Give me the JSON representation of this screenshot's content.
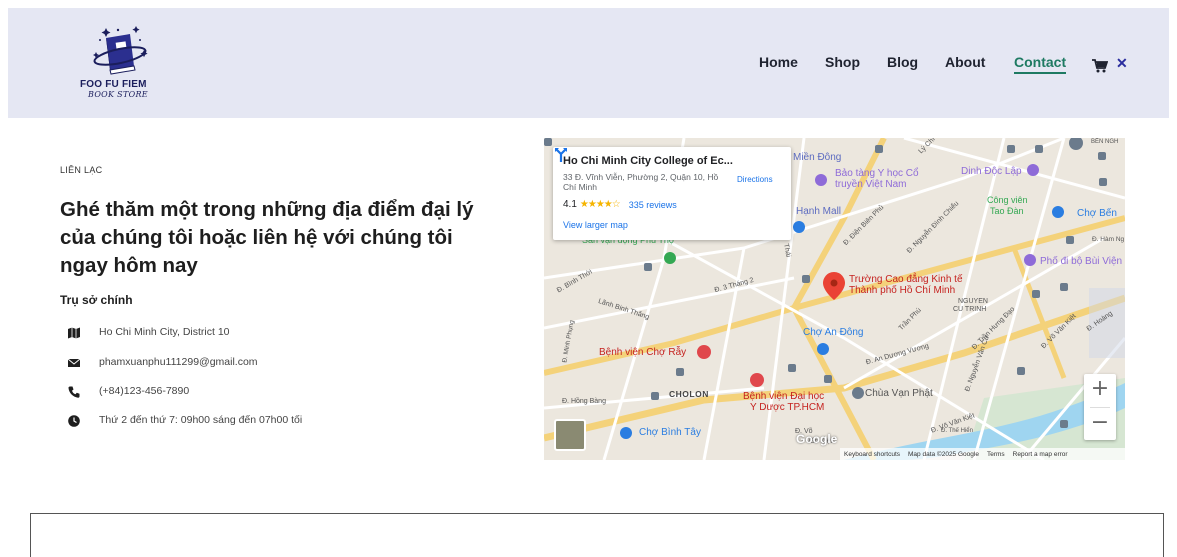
{
  "header": {
    "logo": {
      "line1": "FOO FU FIEM",
      "line2": "BOOK STORE"
    },
    "nav": [
      {
        "label": "Home"
      },
      {
        "label": "Shop"
      },
      {
        "label": "Blog"
      },
      {
        "label": "About"
      },
      {
        "label": "Contact",
        "active": true
      }
    ],
    "cart_icon": "cart-icon",
    "close_icon": "close-icon",
    "close_glyph": "✕",
    "colors": {
      "background": "#e5e7f3",
      "active": "#1e7a62",
      "text": "#1f2330"
    }
  },
  "contact": {
    "eyebrow": "LIÊN LẠC",
    "headline": "Ghé thăm một trong những địa điểm đại lý của chúng tôi hoặc liên hệ với chúng tôi ngay hôm nay",
    "hq_title": "Trụ sở chính",
    "items": [
      {
        "icon": "map-icon",
        "text": "Ho Chi Minh City, District 10"
      },
      {
        "icon": "envelope-icon",
        "text": "phamxuanphu111299@gmail.com"
      },
      {
        "icon": "phone-icon",
        "text": "(+84)123-456-7890"
      },
      {
        "icon": "clock-icon",
        "text": "Thứ 2 đến thứ 7: 09h00 sáng đến 07h00 tối"
      }
    ]
  },
  "map": {
    "card": {
      "title": "Ho Chi Minh City College of Ec...",
      "address": "33 Đ. Vĩnh Viễn, Phường 2, Quận 10, Hồ Chí Minh",
      "rating": "4.1",
      "stars": "★★★★☆",
      "reviews": "335 reviews",
      "link": "View larger map",
      "directions": "Directions"
    },
    "labels": [
      "Miền Đông",
      "Bảo tàng Y học Cổ",
      "truyền Việt Nam",
      "Dinh Độc Lập",
      "Công viên",
      "Tao Đàn",
      "Chợ Bến",
      "Hạnh Mall",
      "Sân vận động Phú Thọ",
      "Trường Cao đẳng Kinh tế",
      "Thành phố Hồ Chí Minh",
      "NGUYEN",
      "CU TRINH",
      "Phố đi bộ Bùi Viện",
      "Chợ An Đông",
      "Bệnh viện Chợ Rẫy",
      "CHOLON",
      "Bệnh viện Đại học",
      "Y Dược TP.HCM",
      "Chùa Vạn Phật",
      "Chợ Bình Tây",
      "BẾN NGH",
      "Đ. Hàm Ng",
      "Đ. Hồng Bàng",
      "Đ. 3 Tháng 2",
      "Lãnh Binh Thăng",
      "Đ. Minh Phụng",
      "Đ. An Dương Vương",
      "Đ. Nguyễn Văn Cừ",
      "Đ. Trần Hưng Đạo",
      "Đ. Võ Văn Kiệt",
      "Đ. Bình Thới",
      "Đ. Điện Biên Phủ",
      "Đ. Nguyễn Đình Chiểu",
      "Đ. Hoàng",
      "Đ. Võ Văn Kiệt",
      "Trần Phú",
      "Lý Chí",
      "Thái",
      "Đ. Thế Hiển",
      "Đ. Võ",
      "Văn Kiệt"
    ],
    "zoom_in": "+",
    "zoom_out": "−",
    "attribution": {
      "keyboard": "Keyboard shortcuts",
      "data": "Map data ©2025 Google",
      "terms": "Terms",
      "report": "Report a map error"
    },
    "google": "Google"
  }
}
